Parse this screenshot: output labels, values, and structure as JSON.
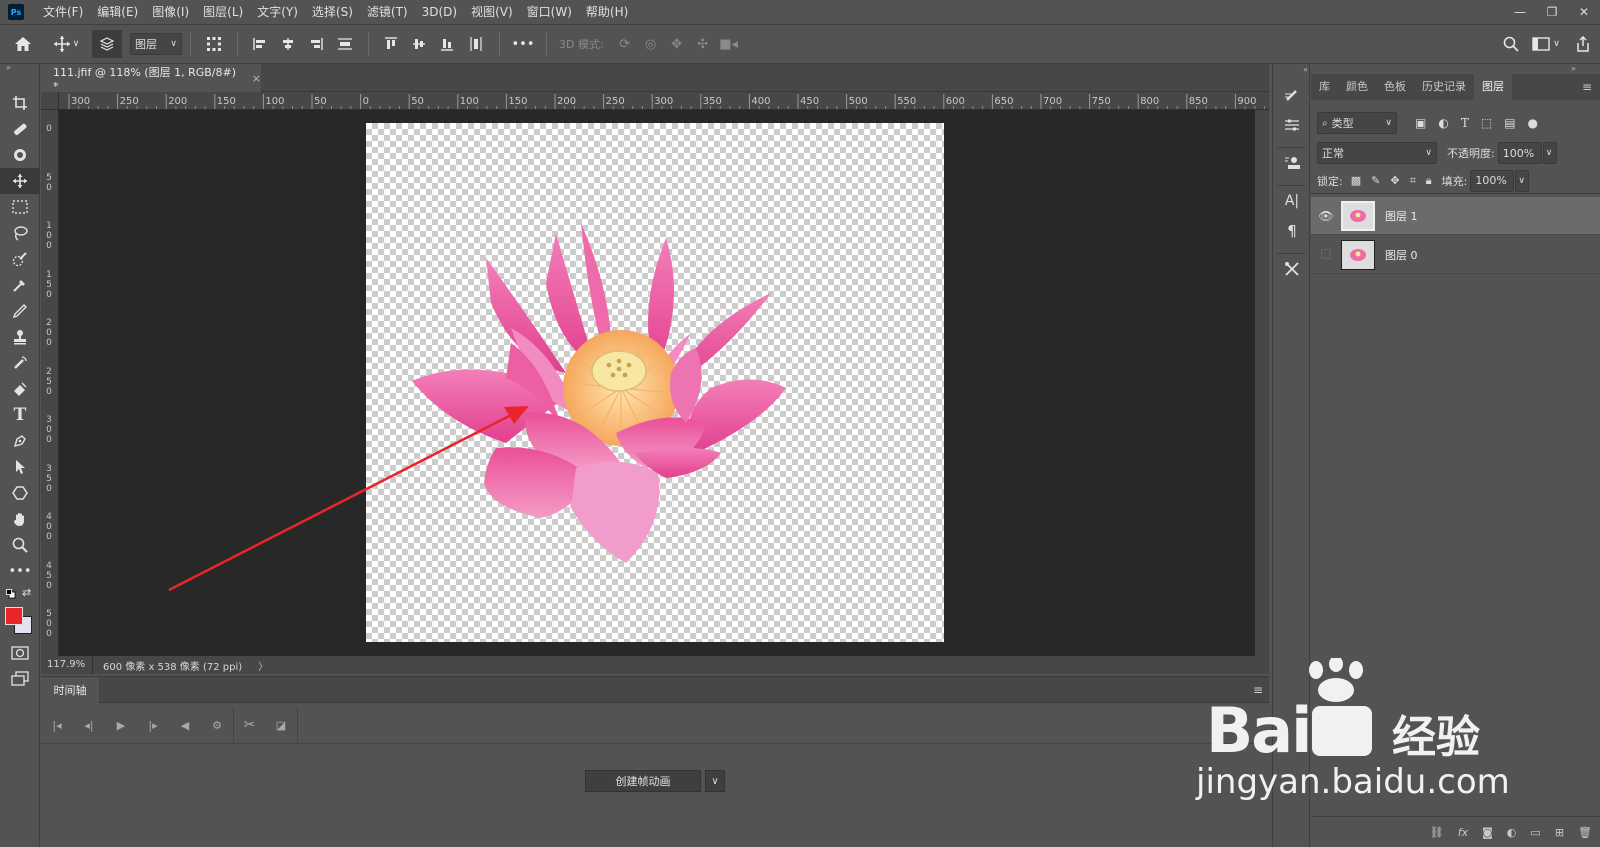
{
  "app": {
    "logo": "Ps",
    "document_tab": "111.jfif @ 118% (图层 1, RGB/8#) *",
    "tab_close": "×"
  },
  "menu": [
    "文件(F)",
    "编辑(E)",
    "图像(I)",
    "图层(L)",
    "文字(Y)",
    "选择(S)",
    "滤镜(T)",
    "3D(D)",
    "视图(V)",
    "窗口(W)",
    "帮助(H)"
  ],
  "window_controls": [
    "—",
    "❐",
    "✕"
  ],
  "options": {
    "layer_select": "图层",
    "mode_3d": "3D 模式:",
    "more": "•••"
  },
  "ruler_top": [
    "300",
    "250",
    "200",
    "150",
    "100",
    "50",
    "0",
    "50",
    "100",
    "150",
    "200",
    "250",
    "300",
    "350",
    "400",
    "450",
    "500",
    "550",
    "600",
    "650",
    "700",
    "750",
    "800",
    "850",
    "900"
  ],
  "ruler_left": [
    "0",
    "5 0",
    "1 0 0",
    "1 5 0",
    "2 0 0",
    "2 5 0",
    "3 0 0",
    "3 5 0",
    "4 0 0",
    "4 5 0",
    "5 0 0"
  ],
  "status": {
    "zoom": "117.9%",
    "doc_info": "600 像素 x 538 像素 (72 ppi)",
    "arrow": "〉"
  },
  "timeline": {
    "tab": "时间轴",
    "create_button": "创建帧动画",
    "dropdown": "∨"
  },
  "panels": {
    "tabs": [
      "库",
      "颜色",
      "色板",
      "历史记录",
      "图层"
    ],
    "active_tab": "图层",
    "filter_kind": "类型",
    "blend_mode": "正常",
    "opacity_label": "不透明度:",
    "opacity_value": "100%",
    "lock_label": "锁定:",
    "fill_label": "填充:",
    "fill_value": "100%",
    "layers": [
      {
        "name": "图层 1",
        "visible": true,
        "selected": true
      },
      {
        "name": "图层 0",
        "visible": false,
        "selected": false
      }
    ],
    "bottom_icons": [
      "fx"
    ]
  },
  "colors": {
    "foreground": "#e8262a",
    "background": "#e6e0f4",
    "annotation_arrow": "#e8262a",
    "petal": "#f06aa8"
  },
  "watermark": {
    "brand": "Bai",
    "brand_cn": "经验",
    "url": "jingyan.baidu.com"
  }
}
